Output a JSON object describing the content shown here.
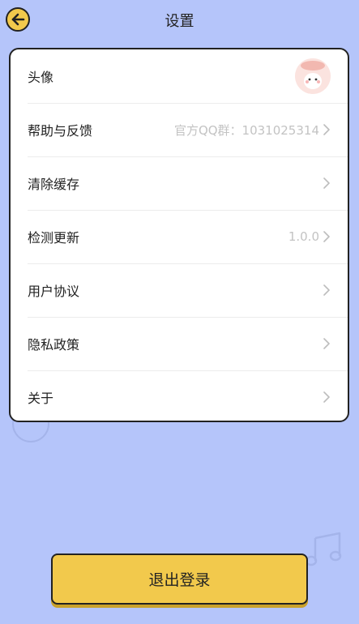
{
  "header": {
    "title": "设置"
  },
  "settings": {
    "rows": [
      {
        "label": "头像",
        "value": ""
      },
      {
        "label": "帮助与反馈",
        "value": "官方QQ群：1031025314"
      },
      {
        "label": "清除缓存",
        "value": ""
      },
      {
        "label": "检测更新",
        "value": "1.0.0"
      },
      {
        "label": "用户协议",
        "value": ""
      },
      {
        "label": "隐私政策",
        "value": ""
      },
      {
        "label": "关于",
        "value": ""
      }
    ]
  },
  "footer": {
    "logout_label": "退出登录"
  },
  "icons": {
    "back": "arrow-left-icon",
    "chevron": "chevron-right-icon",
    "avatar": "avatar-image",
    "decoration": "music-note-icon"
  },
  "colors": {
    "background": "#b5c5fa",
    "accent": "#f2c94c",
    "card": "#ffffff",
    "text": "#222222",
    "muted": "#c3c3c3"
  }
}
